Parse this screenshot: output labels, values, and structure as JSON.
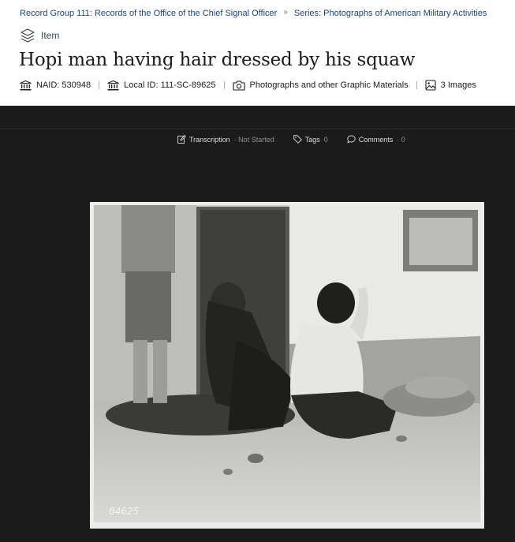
{
  "breadcrumb": {
    "record_group": "Record Group 111: Records of the Office of the Chief Signal Officer",
    "separator": "»",
    "series": "Series: Photographs of American Military Activities"
  },
  "item_type": {
    "icon": "layers-icon",
    "label": "Item"
  },
  "title": "Hopi man having hair dressed by his squaw",
  "meta": {
    "naid": "NAID: 530948",
    "local_id": "Local ID: 111-SC-89625",
    "media_type": "Photographs and other Graphic Materials",
    "images": "3 Images"
  },
  "viewer": {
    "transcription_label": "Transcription",
    "transcription_status": "· Not Started",
    "tags_label": "Tags",
    "tags_count": "0",
    "comments_label": "Comments",
    "comments_count": "· 0"
  },
  "photo": {
    "negative_number": "84625"
  },
  "colors": {
    "link": "#1a4480",
    "viewer_bg": "#1b1b1b",
    "text": "#1b1b1b"
  }
}
